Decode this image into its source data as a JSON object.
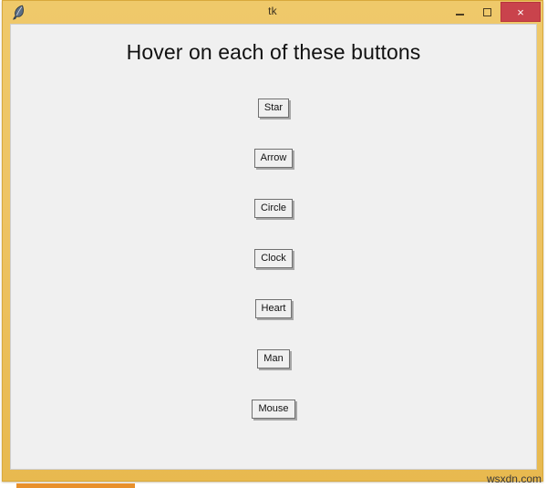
{
  "window": {
    "title": "tk",
    "icon": "feather-quill-icon",
    "frame_color": "#eec465",
    "client_bg": "#f0f0f0",
    "controls": {
      "minimize_label": "–",
      "maximize_label": "□",
      "close_label": "×",
      "close_bg": "#c9434c"
    }
  },
  "main": {
    "heading": "Hover on each of these buttons",
    "buttons": [
      {
        "label": "Star"
      },
      {
        "label": "Arrow"
      },
      {
        "label": "Circle"
      },
      {
        "label": "Clock"
      },
      {
        "label": "Heart"
      },
      {
        "label": "Man"
      },
      {
        "label": "Mouse"
      }
    ]
  },
  "watermark": {
    "text": "wsxdn.com"
  }
}
